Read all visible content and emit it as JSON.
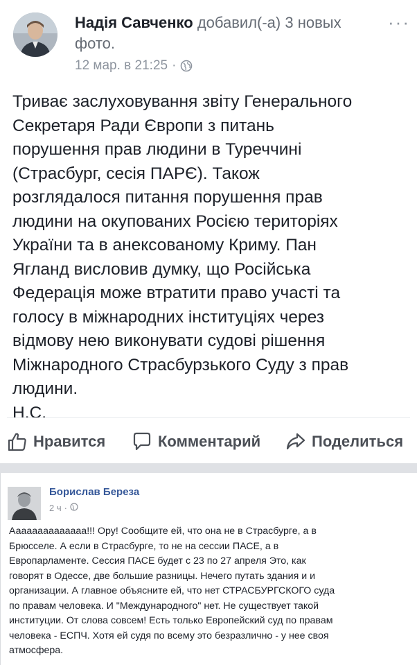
{
  "post1": {
    "author": "Надія Савченко",
    "action": "добавил(-а) 3 новых фото.",
    "timestamp": "12 мар. в 21:25",
    "separator": "·",
    "more_label": "···",
    "body_lines": [
      "Триває заслуховування звіту Генерального",
      "Секретаря Ради Європи з питань",
      "порушення прав людини в Туреччині",
      "(Страсбург, сесія ПАРЄ). Також",
      "розглядалося питання порушення прав",
      "людини на окупованих Росією територіях",
      "України та в анексованому Криму. Пан",
      "Ягланд висловив думку, що Російська",
      "Федерація може втратити право участі та",
      "голосу в міжнародних інституціях через",
      "відмову нею виконувати судові рішення",
      "Міжнародного Страсбурзького Суду з прав",
      "людини.",
      "Н.С."
    ],
    "actions": {
      "like": "Нравится",
      "comment": "Комментарий",
      "share": "Поделиться"
    }
  },
  "post2": {
    "author": "Борислав Береза",
    "timestamp": "2 ч",
    "separator": "·",
    "body_lines": [
      "Аааааааааааааа!!! Ору! Сообщите ей, что она не в Страсбурге, а в",
      "Брюсселе. А если в Страсбурге, то не на сессии ПАСЕ, а в",
      "Европарламенте. Сессия ПАСЕ будет с 23 по 27 апреля Это, как",
      "говорят в Одессе, две большие разницы. Нечего путать здания и и",
      "организации. А главное объясните ей, что нет СТРАСБУРГСКОГО суда",
      "по правам человека. И \"Международного\" нет. Не существует такой",
      "институции. От слова совсем! Есть только Европейский суд по правам",
      "человека - ЕСПЧ. Хотя ей судя по всему это безразлично - у нее своя",
      "атмосфера."
    ]
  }
}
